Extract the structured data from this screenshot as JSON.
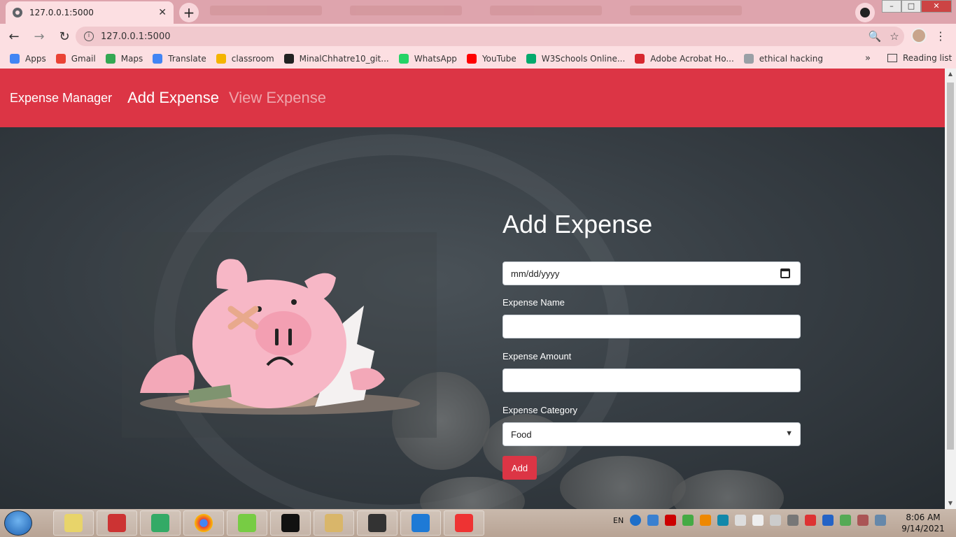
{
  "browser": {
    "tab_title": "127.0.0.1:5000",
    "tab_close": "✕",
    "new_tab": "+",
    "url": "127.0.0.1:5000",
    "back": "←",
    "forward": "→",
    "reload": "↻",
    "zoom_icon": "🔍",
    "star_icon": "☆",
    "menu_icon": "⋮",
    "window_controls": {
      "minimize": "–",
      "maximize": "□",
      "close": "✕"
    }
  },
  "bookmarks": [
    {
      "label": "Apps",
      "icon": "apps-grid-icon",
      "color": "#4285f4"
    },
    {
      "label": "Gmail",
      "icon": "gmail-icon",
      "color": "#ea4335"
    },
    {
      "label": "Maps",
      "icon": "maps-icon",
      "color": "#34a853"
    },
    {
      "label": "Translate",
      "icon": "translate-icon",
      "color": "#4285f4"
    },
    {
      "label": "classroom",
      "icon": "classroom-icon",
      "color": "#f4b400"
    },
    {
      "label": "MinalChhatre10_git...",
      "icon": "github-icon",
      "color": "#222222"
    },
    {
      "label": "WhatsApp",
      "icon": "whatsapp-icon",
      "color": "#25d366"
    },
    {
      "label": "YouTube",
      "icon": "youtube-icon",
      "color": "#ff0000"
    },
    {
      "label": "W3Schools Online...",
      "icon": "w3schools-icon",
      "color": "#04aa6d"
    },
    {
      "label": "Adobe Acrobat Ho...",
      "icon": "acrobat-icon",
      "color": "#d7282f"
    },
    {
      "label": "ethical hacking",
      "icon": "globe-icon",
      "color": "#9aa0a6"
    }
  ],
  "bookmarks_more": "»",
  "reading_list": "Reading list",
  "app": {
    "brand": "Expense Manager",
    "nav": {
      "add": "Add Expense",
      "view": "View Expense"
    },
    "accent": "#dc3545",
    "form": {
      "title": "Add Expense",
      "date_placeholder": "mm/dd/yyyy",
      "name_label": "Expense Name",
      "name_value": "",
      "amount_label": "Expense Amount",
      "amount_value": "",
      "category_label": "Expense Category",
      "category_value": "Food",
      "submit": "Add"
    }
  },
  "taskbar": {
    "language": "EN",
    "time": "8:06 AM",
    "date": "9/14/2021",
    "apps": [
      "file-explorer",
      "ms-todo",
      "task-manager",
      "chrome",
      "notepad-plus",
      "command-prompt",
      "libraries",
      "media-player-classic",
      "vscode",
      "wps-office"
    ]
  }
}
